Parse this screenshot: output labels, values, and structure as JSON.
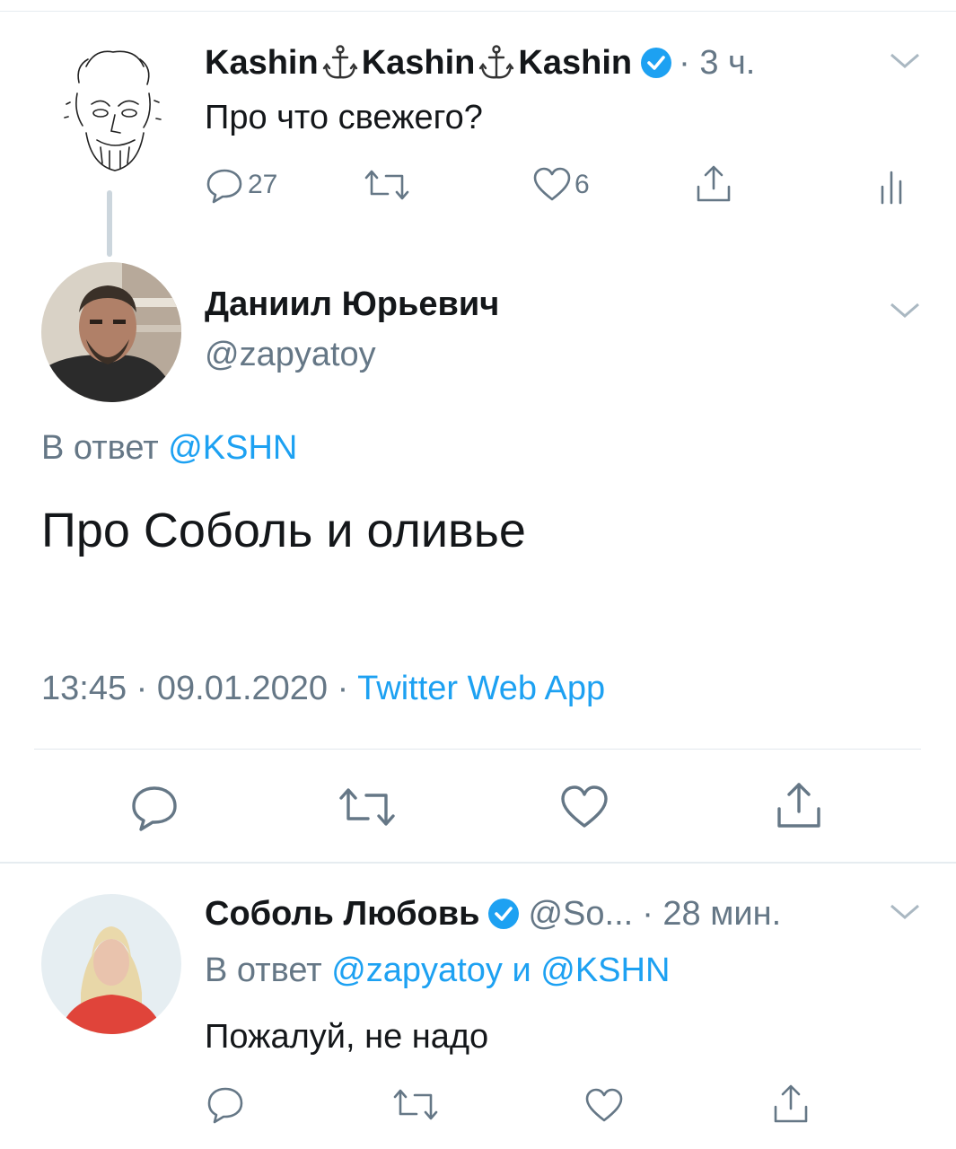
{
  "tweet1": {
    "name_part1": "Kashin",
    "name_part2": "Kashin",
    "name_part3": "Kashin",
    "verified": true,
    "time": "· 3 ч.",
    "text": "Про что свежего?",
    "replies": "27",
    "likes": "6"
  },
  "tweet2": {
    "name": "Даниил Юрьевич",
    "handle": "@zapyatoy",
    "reply_prefix": "В ответ",
    "reply_to": "@KSHN",
    "text": "Про Соболь и оливье",
    "time": "13:45",
    "date": "09.01.2020",
    "sep": "·",
    "source": "Twitter Web App"
  },
  "tweet3": {
    "name": "Соболь Любовь",
    "verified": true,
    "handle": "@So...",
    "time": "· 28 мин.",
    "reply_prefix": "В ответ",
    "reply_to1": "@zapyatoy",
    "reply_and": "и",
    "reply_to2": "@KSHN",
    "text": "Пожалуй, не надо"
  },
  "colors": {
    "accent": "#1da1f2",
    "secondary_text": "#657786",
    "divider": "#e1e8ed"
  }
}
